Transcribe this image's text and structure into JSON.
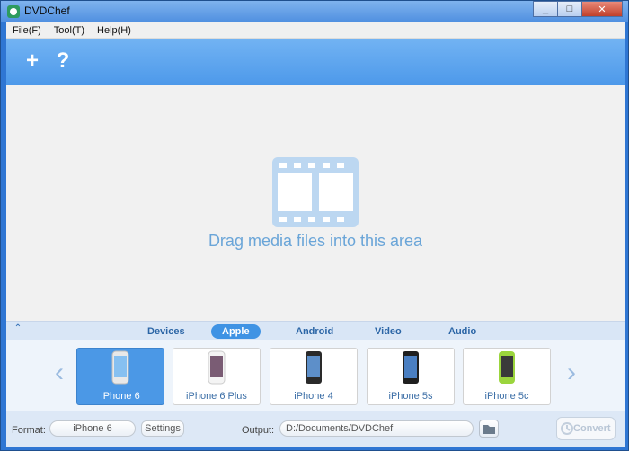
{
  "window": {
    "title": "DVDChef"
  },
  "menu": [
    "File(F)",
    "Tool(T)",
    "Help(H)"
  ],
  "toolbar": {
    "add_icon": "plus-icon",
    "help_icon": "question-icon",
    "add_glyph": "+",
    "help_glyph": "?"
  },
  "dropzone": {
    "text": "Drag media files into this area"
  },
  "tabs": [
    {
      "label": "Devices",
      "active": false
    },
    {
      "label": "Apple",
      "active": true
    },
    {
      "label": "Android",
      "active": false
    },
    {
      "label": "Video",
      "active": false
    },
    {
      "label": "Audio",
      "active": false
    }
  ],
  "devices": [
    {
      "label": "iPhone 6",
      "selected": true
    },
    {
      "label": "iPhone 6 Plus",
      "selected": false
    },
    {
      "label": "iPhone 4",
      "selected": false
    },
    {
      "label": "iPhone 5s",
      "selected": false
    },
    {
      "label": "iPhone 5c",
      "selected": false
    }
  ],
  "bottom": {
    "format_label": "Format:",
    "format_value": "iPhone 6",
    "settings_label": "Settings",
    "output_label": "Output:",
    "output_path": "D:/Documents/DVDChef",
    "convert_label": "Convert"
  },
  "colors": {
    "accent": "#4b98e6",
    "toolbar": "#5aa3ee",
    "dropzone_text": "#6aa5d8"
  }
}
